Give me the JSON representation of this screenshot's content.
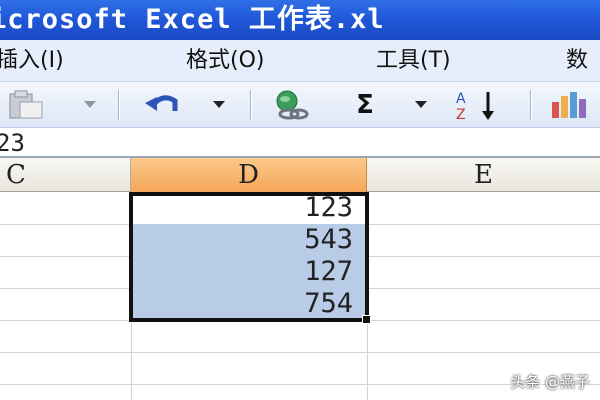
{
  "window": {
    "title": "icrosoft Excel 工作表.xl"
  },
  "menu": {
    "items": [
      {
        "label": "插入(I)"
      },
      {
        "label": "格式(O)"
      },
      {
        "label": "工具(T)"
      },
      {
        "label": "数"
      }
    ]
  },
  "toolbar": {
    "buttons": [
      {
        "icon": "paste-icon"
      },
      {
        "icon": "dropdown-arrow-icon"
      },
      {
        "icon": "undo-icon"
      },
      {
        "icon": "dropdown-arrow-icon"
      },
      {
        "icon": "hyperlink-globe-icon"
      },
      {
        "icon": "autosum-icon",
        "label": "Σ"
      },
      {
        "icon": "dropdown-arrow-icon"
      },
      {
        "icon": "sort-ascending-icon"
      },
      {
        "icon": "chart-wizard-icon"
      }
    ]
  },
  "formula_bar": {
    "value": "23"
  },
  "columns": [
    {
      "label": "C"
    },
    {
      "label": "D",
      "selected": true
    },
    {
      "label": "E"
    }
  ],
  "cells": {
    "column": "D",
    "values": [
      "123",
      "543",
      "127",
      "754"
    ]
  },
  "colors": {
    "title_bar": "#1e54d6",
    "selected_header": "#f4a659",
    "selection_fill": "#b8cce8"
  },
  "watermark": {
    "text": "头条 @燕子"
  }
}
